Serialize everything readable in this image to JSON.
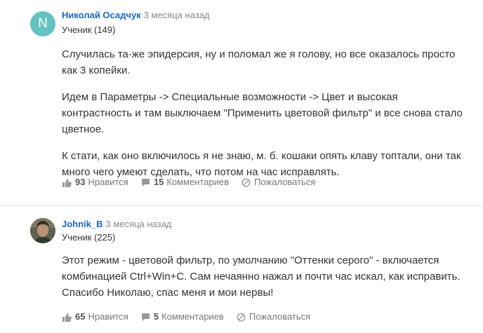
{
  "comments": [
    {
      "avatar_letter": "N",
      "author": "Николай Осадчук",
      "time": "3 месяца назад",
      "rank": "Ученик (149)",
      "paragraphs": [
        "Случилась та-же эпидерсия, ну и поломал же я голову, но все оказалось просто как 3 копейки.",
        "Идем в Параметры -> Специальные возможности -> Цвет и высокая контрастность и там выключаем \"Применить цветовой фильтр\" и все снова стало цветное.",
        "К стати, как оно включилось я не знаю, м. б. кошаки опять клаву топтали, они так много чего умеют сделать, что потом на час исправлять."
      ],
      "likes": "93",
      "likes_label": "Нравится",
      "comments_count": "15",
      "comments_label": "Комментариев",
      "report_label": "Пожаловаться"
    },
    {
      "author": "Johnik_B",
      "time": "3 месяца назад",
      "rank": "Ученик (225)",
      "paragraphs": [
        "Этот режим - цветовой фильтр, по умолчанию \"Оттенки серого\" - включается комбинацией Ctrl+Win+C. Сам нечаянно нажал и почти час искал, как исправить. Спасибо Николаю, спас меня и мои нервы!"
      ],
      "likes": "65",
      "likes_label": "Нравится",
      "comments_count": "5",
      "comments_label": "Комментариев",
      "report_label": "Пожаловаться"
    }
  ],
  "colors": {
    "author": "#1a66c9",
    "avatar_bg": "#66c2c0",
    "divider": "#e6e6e6"
  }
}
